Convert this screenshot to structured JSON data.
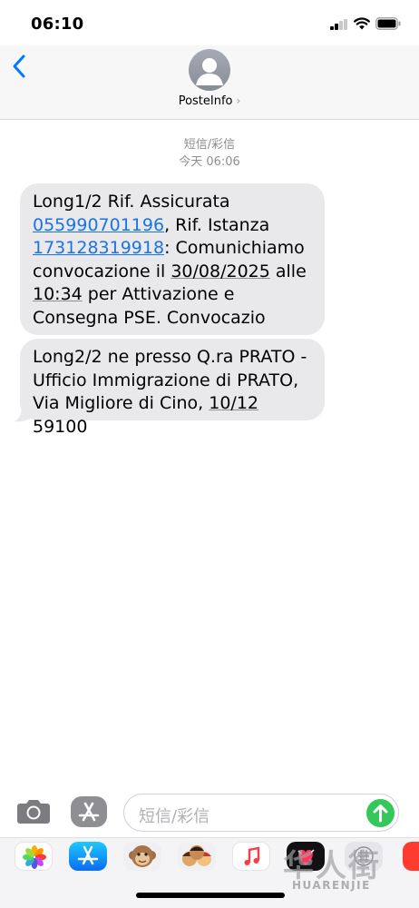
{
  "status_bar": {
    "time": "06:10"
  },
  "header": {
    "back_label": "",
    "contact_name": "PosteInfo",
    "chevron": "›"
  },
  "thread": {
    "message_type": "短信/彩信",
    "timestamp": "今天 06:06",
    "messages": [
      {
        "p1": "Long1/2 Rif. Assicurata ",
        "link1": "055990701196",
        "p2": ", Rif. Istanza ",
        "link2": "173128319918",
        "p3": ": Comunichiamo convocazione il ",
        "date": "30/08/2025",
        "p4": " alle ",
        "time": "10:34",
        "p5": " per Attivazione e Consegna PSE. Convocazio"
      },
      {
        "p1": "Long2/2 ne presso Q.ra PRATO - Ufficio Immigrazione di PRATO, Via Migliore di Cino, ",
        "address_num": "10/12",
        "p2": " 59100"
      }
    ]
  },
  "composer": {
    "placeholder": "短信/彩信"
  },
  "app_drawer": {
    "apps": [
      "photos-icon",
      "app-store-icon",
      "monkey-memoji-icon",
      "memoji-stickers-icon",
      "music-icon",
      "digital-touch-icon",
      "more-apps-icon",
      "partial-app-icon"
    ]
  },
  "watermark": {
    "cjk": "华人街",
    "latin": "HUARENJIE"
  },
  "colors": {
    "link": "#1a73e8",
    "bubble": "#e9e9eb",
    "send": "#34c759",
    "ios_blue": "#007aff"
  }
}
